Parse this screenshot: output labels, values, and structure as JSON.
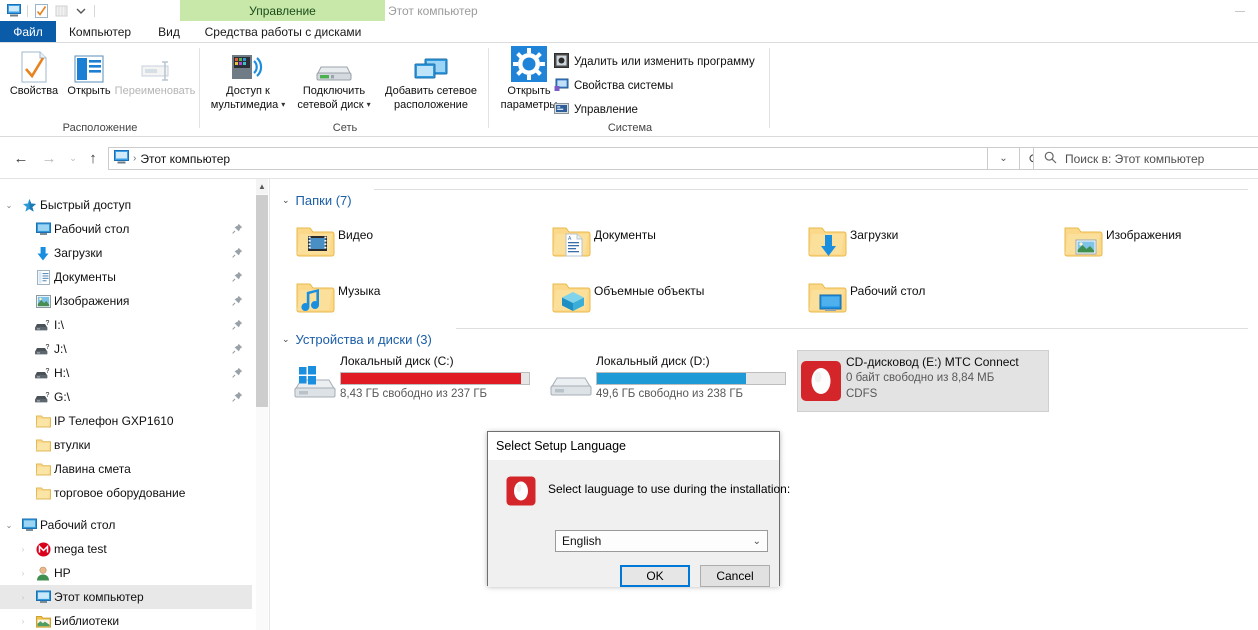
{
  "window": {
    "contextual_tab_label": "Управление",
    "title": "Этот компьютер",
    "minimize_icon": "minimize-icon",
    "qat": [
      {
        "name": "this-pc-icon",
        "label": "Этот компьютер"
      },
      {
        "name": "properties-icon",
        "label": "Свойства"
      },
      {
        "name": "new-folder-icon",
        "label": "Создать папку"
      },
      {
        "name": "customize-qat-icon",
        "label": "Настроить панель быстрого доступа"
      }
    ]
  },
  "tabs": [
    {
      "id": "file",
      "label": "Файл"
    },
    {
      "id": "computer",
      "label": "Компьютер"
    },
    {
      "id": "view",
      "label": "Вид"
    },
    {
      "id": "drive-tools",
      "label": "Средства работы с дисками"
    }
  ],
  "ribbon": {
    "groups": [
      {
        "id": "location",
        "label": "Расположение"
      },
      {
        "id": "network",
        "label": "Сеть"
      },
      {
        "id": "system",
        "label": "Система"
      }
    ],
    "buttons": {
      "properties": "Свойства",
      "open": "Открыть",
      "rename": "Переименовать",
      "media_access_l1": "Доступ к",
      "media_access_l2": "мультимедиа",
      "map_drive_l1": "Подключить",
      "map_drive_l2": "сетевой диск",
      "add_network_l1": "Добавить сетевое",
      "add_network_l2": "расположение",
      "open_settings_l1": "Открыть",
      "open_settings_l2": "параметры",
      "uninstall_program": "Удалить или изменить программу",
      "system_properties": "Свойства системы",
      "manage": "Управление"
    }
  },
  "addressbar": {
    "back_icon": "back-arrow-icon",
    "forward_icon": "forward-arrow-icon",
    "recent_icon": "recent-locations-icon",
    "up_icon": "up-arrow-icon",
    "path_icon": "this-pc-icon",
    "path_text": "Этот компьютер",
    "separator": "›",
    "dropdown_icon": "chevron-down-icon",
    "refresh_icon": "refresh-icon"
  },
  "search": {
    "icon": "search-icon",
    "placeholder": "Поиск в: Этот компьютер",
    "value": ""
  },
  "sidebar": {
    "items": [
      {
        "label": "Быстрый доступ",
        "icon": "star-icon",
        "indent": 0,
        "chevron": "collapsed",
        "pinned": false,
        "selected": false
      },
      {
        "label": "Рабочий стол",
        "icon": "desktop-icon",
        "indent": 1,
        "chevron": "",
        "pinned": true,
        "selected": false
      },
      {
        "label": "Загрузки",
        "icon": "downloads-icon",
        "indent": 1,
        "chevron": "",
        "pinned": true,
        "selected": false
      },
      {
        "label": "Документы",
        "icon": "documents-icon",
        "indent": 1,
        "chevron": "",
        "pinned": true,
        "selected": false
      },
      {
        "label": "Изображения",
        "icon": "pictures-icon",
        "indent": 1,
        "chevron": "",
        "pinned": true,
        "selected": false
      },
      {
        "label": "I:\\",
        "icon": "network-drive-icon",
        "indent": 1,
        "chevron": "",
        "pinned": true,
        "selected": false
      },
      {
        "label": "J:\\",
        "icon": "network-drive-icon",
        "indent": 1,
        "chevron": "",
        "pinned": true,
        "selected": false
      },
      {
        "label": "H:\\",
        "icon": "network-drive-icon",
        "indent": 1,
        "chevron": "",
        "pinned": true,
        "selected": false
      },
      {
        "label": "G:\\",
        "icon": "network-drive-icon",
        "indent": 1,
        "chevron": "",
        "pinned": true,
        "selected": false
      },
      {
        "label": "IP Телефон GXP1610",
        "icon": "folder-icon",
        "indent": 1,
        "chevron": "",
        "pinned": false,
        "selected": false
      },
      {
        "label": "втулки",
        "icon": "folder-icon",
        "indent": 1,
        "chevron": "",
        "pinned": false,
        "selected": false
      },
      {
        "label": "Лавина смета",
        "icon": "folder-icon",
        "indent": 1,
        "chevron": "",
        "pinned": false,
        "selected": false
      },
      {
        "label": "торговое оборудование",
        "icon": "folder-icon",
        "indent": 1,
        "chevron": "",
        "pinned": false,
        "selected": false
      },
      {
        "label": "Рабочий стол",
        "icon": "desktop-icon",
        "indent": 0,
        "chevron": "collapsed",
        "pinned": false,
        "selected": false
      },
      {
        "label": "mega test",
        "icon": "mega-icon",
        "indent": 1,
        "chevron": "expandable",
        "pinned": false,
        "selected": false
      },
      {
        "label": "HP",
        "icon": "user-icon",
        "indent": 1,
        "chevron": "expandable",
        "pinned": false,
        "selected": false
      },
      {
        "label": "Этот компьютер",
        "icon": "this-pc-icon",
        "indent": 1,
        "chevron": "expandable",
        "pinned": false,
        "selected": true
      },
      {
        "label": "Библиотеки",
        "icon": "libraries-icon",
        "indent": 1,
        "chevron": "expandable",
        "pinned": false,
        "selected": false
      }
    ],
    "scrollbar": {
      "up_arrow_icon": "scroll-up-icon"
    }
  },
  "content": {
    "folders_group": {
      "label": "Папки (7)",
      "chevron": "expanded",
      "items": [
        {
          "label": "Видео",
          "icon": "folder-video-icon"
        },
        {
          "label": "Документы",
          "icon": "folder-documents-icon"
        },
        {
          "label": "Загрузки",
          "icon": "folder-downloads-icon"
        },
        {
          "label": "Изображения",
          "icon": "folder-pictures-icon"
        },
        {
          "label": "Музыка",
          "icon": "folder-music-icon"
        },
        {
          "label": "Объемные объекты",
          "icon": "folder-3dobjects-icon"
        },
        {
          "label": "Рабочий стол",
          "icon": "folder-desktop-icon"
        }
      ]
    },
    "drives_group": {
      "label": "Устройства и диски (3)",
      "chevron": "expanded",
      "items": [
        {
          "name": "Локальный диск (C:)",
          "free_text": "8,43 ГБ свободно из 237 ГБ",
          "used_percent": 96,
          "bar_color": "#e01b24",
          "icon": "windows-drive-icon",
          "selected": false,
          "filesystem": ""
        },
        {
          "name": "Локальный диск (D:)",
          "free_text": "49,6 ГБ свободно из 238 ГБ",
          "used_percent": 79,
          "bar_color": "#1e9ad6",
          "icon": "hard-drive-icon",
          "selected": false,
          "filesystem": ""
        },
        {
          "name": "CD-дисковод (E:) MTC Connect",
          "free_text": "0 байт свободно из 8,84 МБ",
          "used_percent": 100,
          "bar_color": "",
          "icon": "cd-drive-mts-icon",
          "selected": true,
          "filesystem": "CDFS"
        }
      ]
    }
  },
  "dialog": {
    "title": "Select Setup Language",
    "icon": "mts-connect-icon",
    "message": "Select lauguage to use during the installation:",
    "language_value": "English",
    "dropdown_icon": "chevron-down-icon",
    "ok_label": "OK",
    "cancel_label": "Cancel"
  },
  "colors": {
    "file_tab_blue": "#0b5ca8",
    "contextual_green": "#c8e8a9",
    "accent_blue": "#0078d7",
    "drive_c_red": "#e01b24",
    "drive_d_blue": "#1e9ad6",
    "group_header_blue": "#1b5ea8"
  }
}
